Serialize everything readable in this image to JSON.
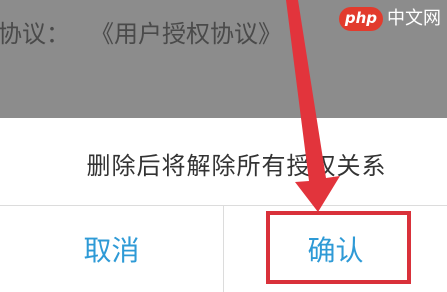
{
  "background": {
    "agreement_prefix": "协议：",
    "agreement_link": "《用户授权协议》"
  },
  "watermark": {
    "logo": "php",
    "text": "中文网"
  },
  "dialog": {
    "message": "删除后将解除所有授权关系",
    "cancel_label": "取消",
    "confirm_label": "确认"
  },
  "colors": {
    "accent": "#2e9ad6",
    "highlight": "#d9313a",
    "backdrop": "#8c8c8c"
  },
  "annotations": {
    "arrow_icon": "red-arrow-icon",
    "highlight": "red-highlight-box"
  }
}
